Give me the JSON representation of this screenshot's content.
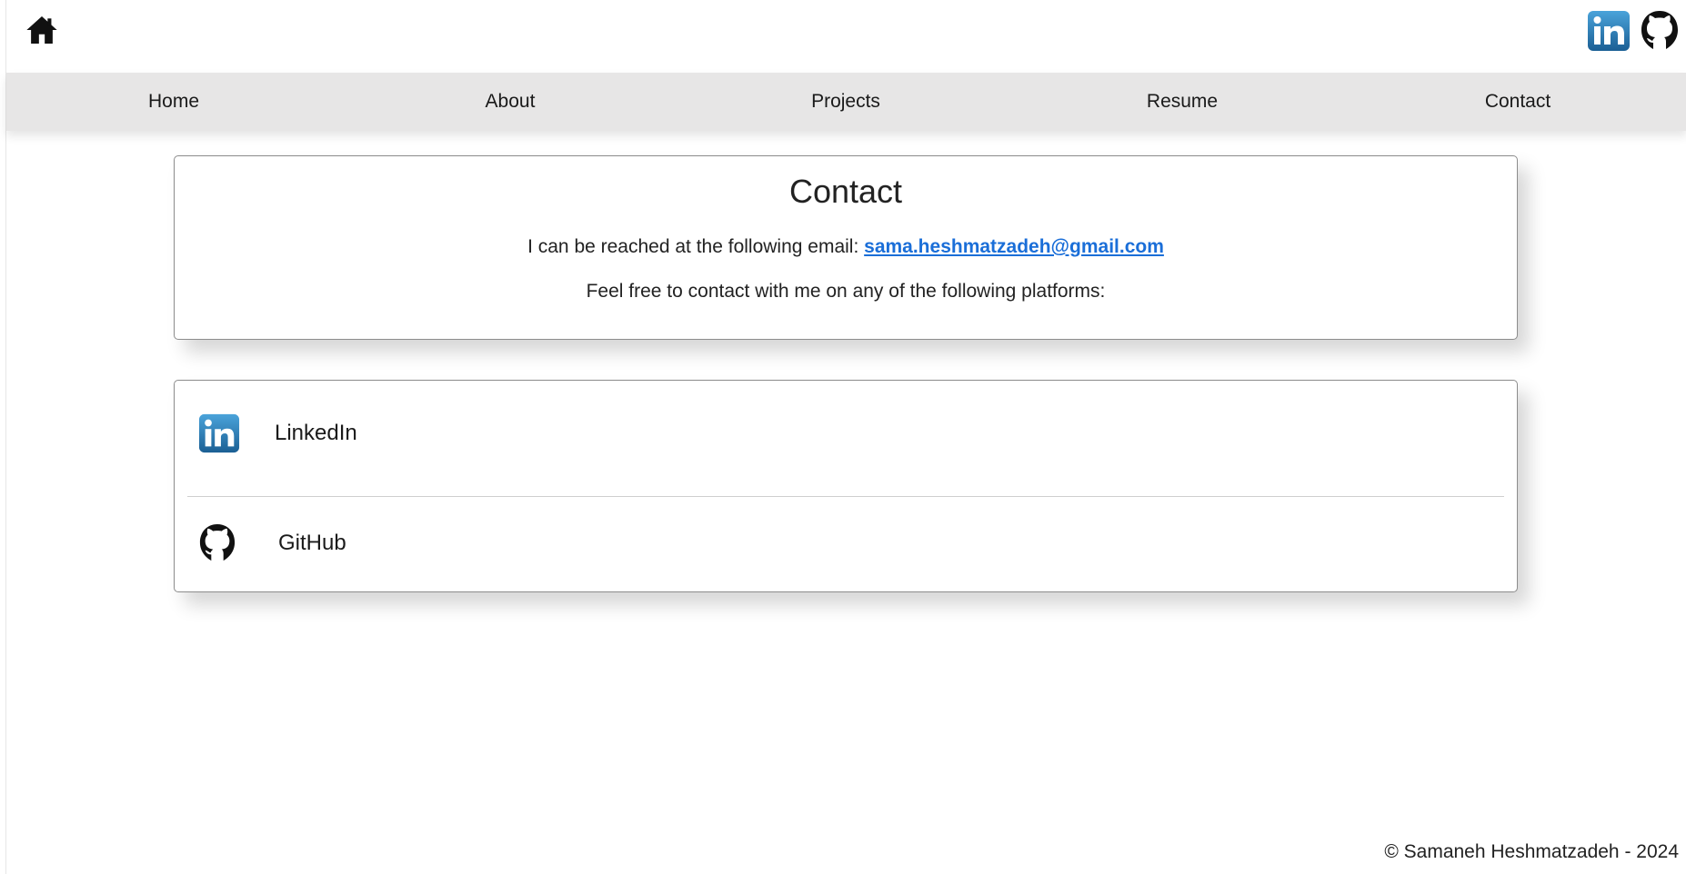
{
  "header": {
    "home_icon": "home-icon",
    "social_icons": [
      "linkedin-icon",
      "github-icon"
    ]
  },
  "nav": {
    "items": [
      "Home",
      "About",
      "Projects",
      "Resume",
      "Contact"
    ]
  },
  "contact": {
    "title": "Contact",
    "email_intro": "I can be reached at the following email: ",
    "email": "sama.heshmatzadeh@gmail.com",
    "platforms_text": "Feel free to contact with me on any of the following platforms:"
  },
  "links": [
    {
      "label": "LinkedIn",
      "icon": "linkedin-icon"
    },
    {
      "label": "GitHub",
      "icon": "github-icon"
    }
  ],
  "footer": {
    "text": "© Samaneh Heshmatzadeh - 2024"
  },
  "colors": {
    "nav_bg": "#e7e6e6",
    "email_link": "#1a6ed8",
    "linkedin_blue": "#1b6fa9"
  }
}
